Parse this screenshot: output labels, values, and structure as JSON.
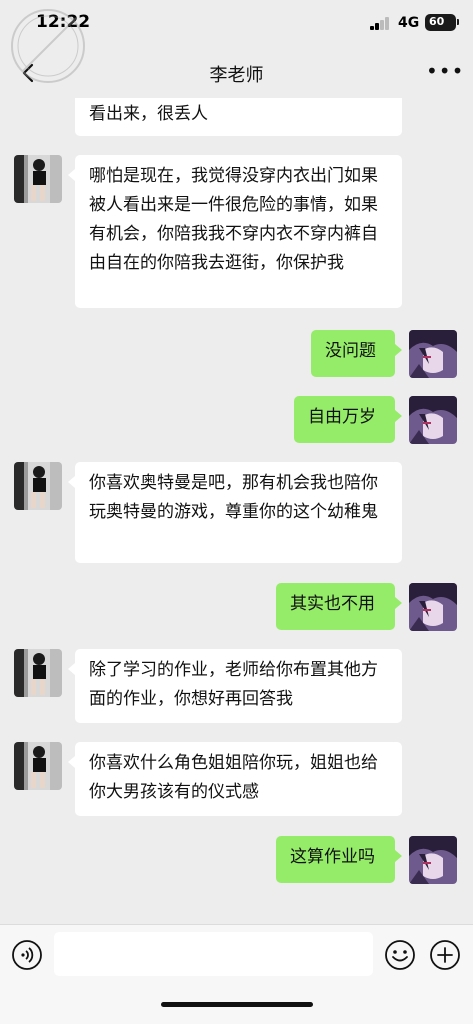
{
  "status_bar": {
    "time": "12:22",
    "network": "4G",
    "battery": "60"
  },
  "header": {
    "title": "李老师",
    "more_label": "•••"
  },
  "messages": [
    {
      "side": "in",
      "text": "看出来，很丢人"
    },
    {
      "side": "in",
      "text": "哪怕是现在，我觉得没穿内衣出门如果被人看出来是一件很危险的事情，如果有机会，你陪我我不穿内衣不穿内裤自由自在的你陪我去逛街，你保护我"
    },
    {
      "side": "out",
      "text": "没问题"
    },
    {
      "side": "out",
      "text": "自由万岁"
    },
    {
      "side": "in",
      "text": "你喜欢奥特曼是吧，那有机会我也陪你玩奥特曼的游戏，尊重你的这个幼稚鬼"
    },
    {
      "side": "out",
      "text": "其实也不用"
    },
    {
      "side": "in",
      "text": "除了学习的作业，老师给你布置其他方面的作业，你想好再回答我"
    },
    {
      "side": "in",
      "text": "你喜欢什么角色姐姐陪你玩，姐姐也给你大男孩该有的仪式感"
    },
    {
      "side": "out",
      "text": "这算作业吗"
    }
  ],
  "input": {
    "value": "",
    "placeholder": ""
  },
  "icons": {
    "back": "chevron-left-icon",
    "more": "more-dots-icon",
    "voice": "voice-icon",
    "emoji": "emoji-icon",
    "plus": "plus-icon"
  },
  "colors": {
    "background": "#ededed",
    "incoming_bubble": "#ffffff",
    "outgoing_bubble": "#95ec69",
    "input_bar": "#f7f7f7"
  }
}
